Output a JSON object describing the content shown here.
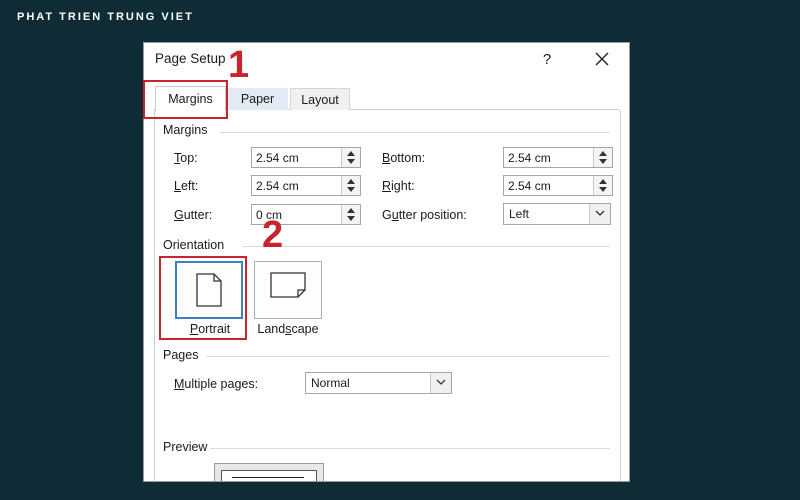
{
  "brand": {
    "text": "PHAT TRIEN TRUNG VIET"
  },
  "dialog": {
    "title": "Page Setup",
    "help_label": "?",
    "tabs": [
      {
        "label": "Margins",
        "selected": true
      },
      {
        "label": "Paper",
        "selected": false
      },
      {
        "label": "Layout",
        "selected": false
      }
    ]
  },
  "margins": {
    "section_label": "Margins",
    "top": {
      "label_u": "T",
      "label_rest": "op:",
      "value": "2.54 cm"
    },
    "bottom": {
      "label_u": "B",
      "label_rest": "ottom:",
      "value": "2.54 cm"
    },
    "left": {
      "label_u": "L",
      "label_rest": "eft:",
      "value": "2.54 cm"
    },
    "right": {
      "label_u": "R",
      "label_rest": "ight:",
      "value": "2.54 cm"
    },
    "gutter": {
      "label_u": "G",
      "label_rest": "utter:",
      "value": "0 cm"
    },
    "gutter_position": {
      "label_u": "u",
      "label_pre": "G",
      "label_rest": "tter position:",
      "value": "Left"
    }
  },
  "orientation": {
    "section_label": "Orientation",
    "portrait": {
      "label_u": "P",
      "label_rest": "ortrait",
      "selected": true
    },
    "landscape": {
      "label_pre": "Land",
      "label_u": "s",
      "label_rest": "cape",
      "selected": false
    }
  },
  "pages": {
    "section_label": "Pages",
    "multiple_pages": {
      "label_u": "M",
      "label_rest": "ultiple pages:",
      "value": "Normal"
    }
  },
  "preview": {
    "section_label": "Preview"
  },
  "annotations": [
    {
      "number": "1",
      "color": "#c8242e"
    },
    {
      "number": "2",
      "color": "#c8242e"
    }
  ]
}
